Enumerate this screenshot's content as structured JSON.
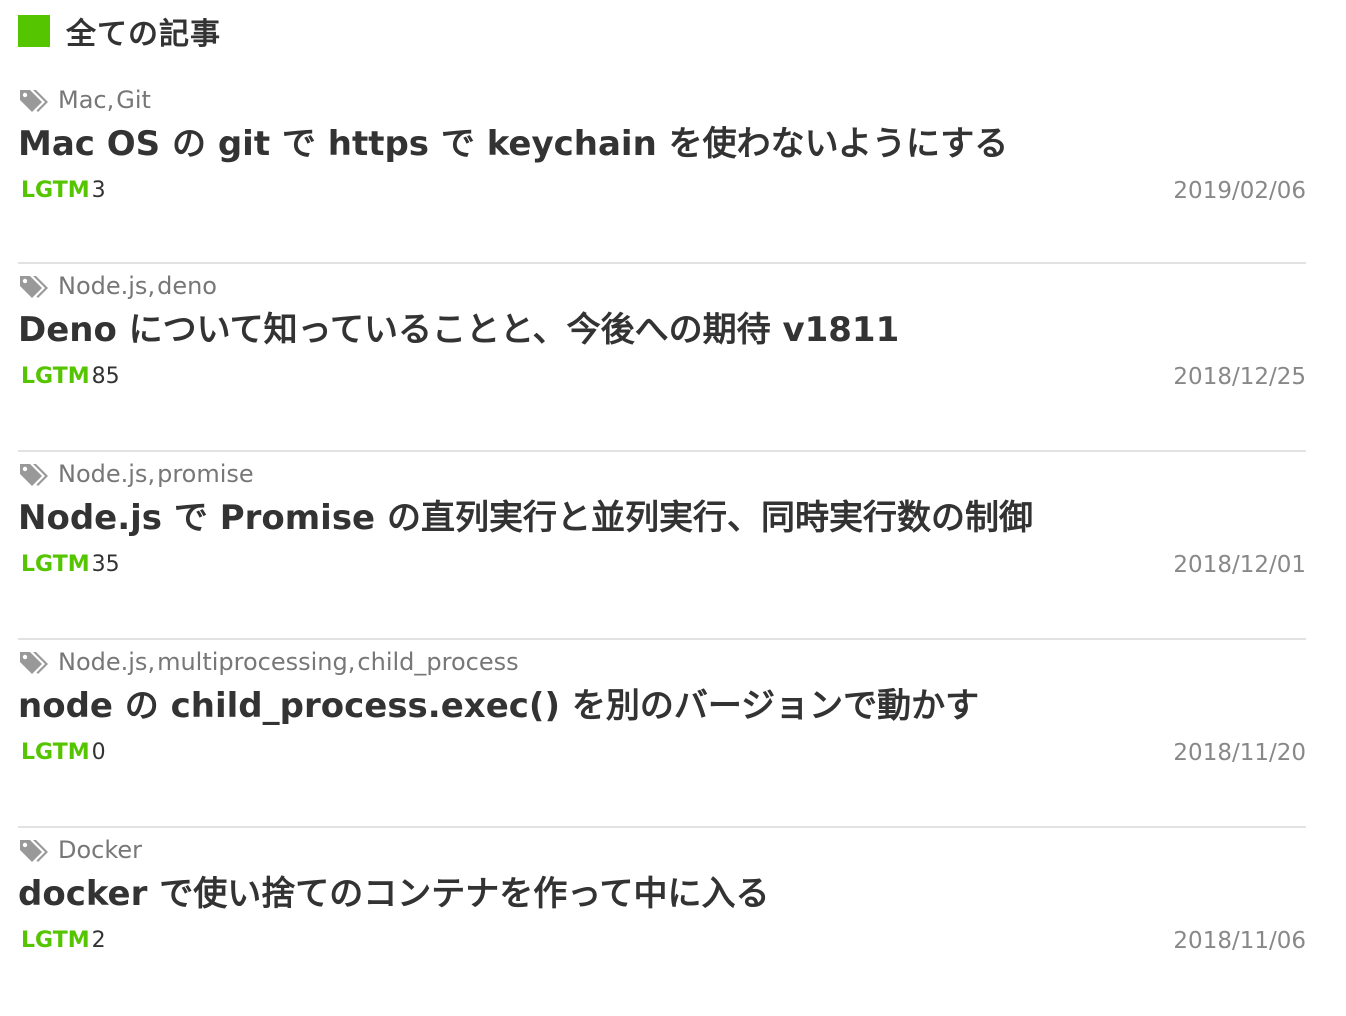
{
  "header": {
    "title": "全ての記事",
    "accent_color": "#55c500"
  },
  "lgtm_label": "LGTM",
  "tag_separator": ",",
  "articles": [
    {
      "tags": [
        "Mac",
        "Git"
      ],
      "title": "Mac OS の git で https で keychain を使わないようにする",
      "lgtm": "3",
      "date": "2019/02/06"
    },
    {
      "tags": [
        "Node.js",
        "deno"
      ],
      "title": "Deno について知っていることと、今後への期待 v1811",
      "lgtm": "85",
      "date": "2018/12/25"
    },
    {
      "tags": [
        "Node.js",
        "promise"
      ],
      "title": "Node.js で Promise の直列実行と並列実行、同時実行数の制御",
      "lgtm": "35",
      "date": "2018/12/01"
    },
    {
      "tags": [
        "Node.js",
        "multiprocessing",
        "child_process"
      ],
      "title": "node の child_process.exec() を別のバージョンで動かす",
      "lgtm": "0",
      "date": "2018/11/20"
    },
    {
      "tags": [
        "Docker"
      ],
      "title": "docker で使い捨てのコンテナを作って中に入る",
      "lgtm": "2",
      "date": "2018/11/06"
    }
  ],
  "icons": {
    "tag": "tags-icon",
    "section": "green-square-marker"
  }
}
